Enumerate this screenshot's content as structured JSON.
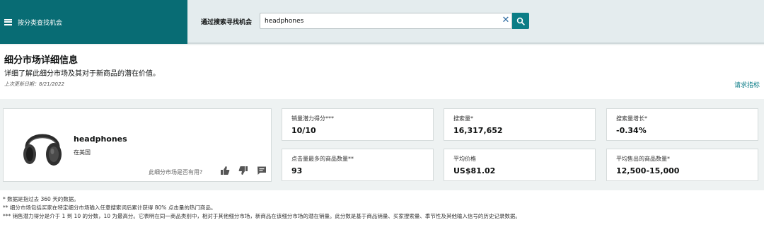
{
  "topbar": {
    "menu_label": "按分类查找机会",
    "search_label": "通过搜索寻找机会",
    "search_value": "headphones",
    "clear_symbol": "✕"
  },
  "header": {
    "title": "细分市场详细信息",
    "subtitle": "详细了解此细分市场及其对于新商品的潜在价值。",
    "updated": "上次更新日期：8/21/2022",
    "request_link": "请求指标"
  },
  "product": {
    "name": "headphones",
    "market": "在美国",
    "feedback_question": "此细分市场是否有用?"
  },
  "metrics": [
    {
      "label": "销量潜力得分***",
      "value": "10/10"
    },
    {
      "label": "搜索量*",
      "value": "16,317,652"
    },
    {
      "label": "搜索量增长*",
      "value": "-0.34%"
    },
    {
      "label": "点击量最多的商品数量**",
      "value": "93"
    },
    {
      "label": "平均价格",
      "value": "US$81.02"
    },
    {
      "label": "平均售出的商品数量*",
      "value": "12,500-15,000"
    }
  ],
  "footnotes": [
    "* 数据是指过去 360 天的数据。",
    "** 细分市场包括买家在特定细分市场输入任意搜索词后累计获得 80% 点击量的热门商品。",
    "*** 销售潜力得分是介于 1 到 10 的分数，10 为最高分。它表明在同一商品类别中，相对于其他细分市场，新商品在该细分市场的潜在销量。此分数是基于商品销量、买家搜索量、季节性及其他输入信号的历史记录数据。"
  ],
  "colors": {
    "accent": "#086c74",
    "link": "#077a85"
  },
  "icons": [
    "hamburger-icon",
    "clear-icon",
    "search-icon",
    "thumbs-up-icon",
    "thumbs-down-icon",
    "comment-icon",
    "headphones-image"
  ]
}
